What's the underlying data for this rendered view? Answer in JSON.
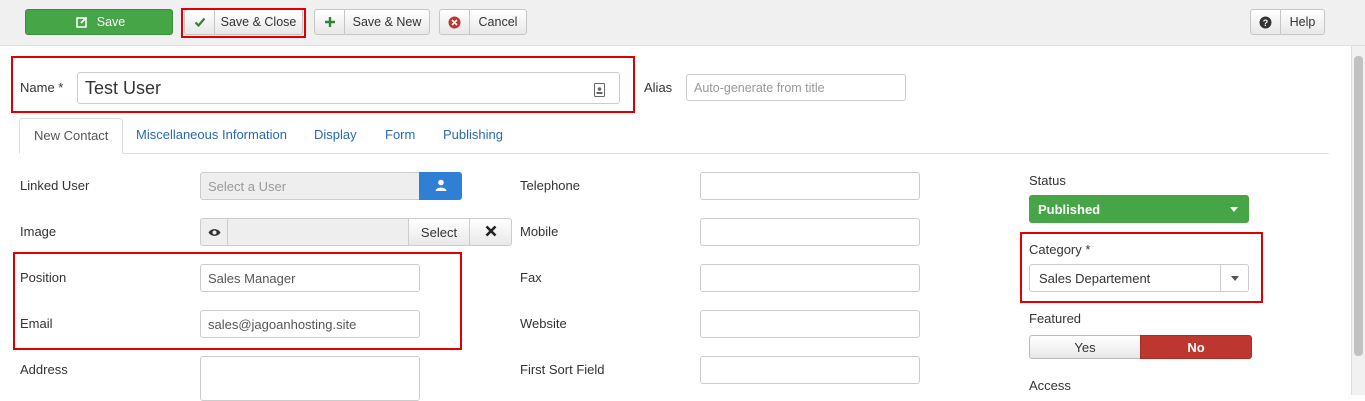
{
  "toolbar": {
    "save_label": "Save",
    "save_close_label": "Save & Close",
    "save_new_label": "Save & New",
    "cancel_label": "Cancel",
    "help_label": "Help"
  },
  "header": {
    "name_label": "Name *",
    "name_value": "Test User",
    "alias_label": "Alias",
    "alias_placeholder": "Auto-generate from title"
  },
  "tabs": [
    {
      "label": "New Contact"
    },
    {
      "label": "Miscellaneous Information"
    },
    {
      "label": "Display"
    },
    {
      "label": "Form"
    },
    {
      "label": "Publishing"
    }
  ],
  "left": {
    "linked_user_label": "Linked User",
    "linked_user_placeholder": "Select a User",
    "image_label": "Image",
    "image_select_label": "Select",
    "position_label": "Position",
    "position_value": "Sales Manager",
    "email_label": "Email",
    "email_value": "sales@jagoanhosting.site",
    "address_label": "Address"
  },
  "middle": {
    "telephone_label": "Telephone",
    "mobile_label": "Mobile",
    "fax_label": "Fax",
    "website_label": "Website",
    "first_sort_label": "First Sort Field"
  },
  "right": {
    "status_label": "Status",
    "status_value": "Published",
    "category_label": "Category *",
    "category_value": "Sales Departement",
    "featured_label": "Featured",
    "featured_yes": "Yes",
    "featured_no": "No",
    "access_label": "Access"
  },
  "colors": {
    "green": "#46a546",
    "red": "#bd362f",
    "link": "#2a69b8",
    "highlight": "#e00000"
  }
}
